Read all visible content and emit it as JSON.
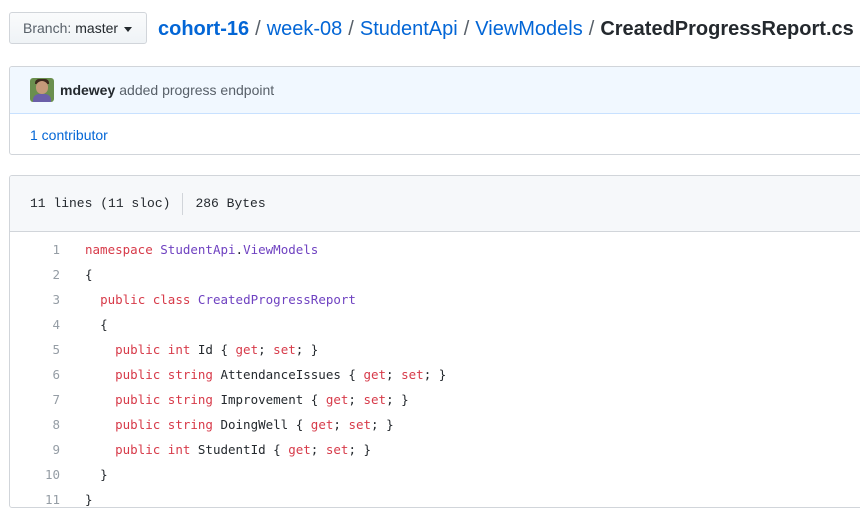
{
  "branch": {
    "prefix": "Branch:",
    "name": "master"
  },
  "breadcrumb": {
    "repo": "cohort-16",
    "parts": [
      "week-08",
      "StudentApi",
      "ViewModels"
    ],
    "file": "CreatedProgressReport.cs",
    "separator": "/"
  },
  "commit": {
    "author": "mdewey",
    "message": "added progress endpoint"
  },
  "contributors": {
    "label": "1 contributor"
  },
  "file_info": {
    "lines": "11 lines (11 sloc)",
    "size": "286 Bytes"
  },
  "code": [
    {
      "num": "1",
      "indent": "",
      "tokens": [
        [
          "kw-ty",
          "namespace"
        ],
        [
          "sp",
          " "
        ],
        [
          "ty",
          "StudentApi"
        ],
        [
          "pl",
          "."
        ],
        [
          "ty",
          "ViewModels"
        ]
      ]
    },
    {
      "num": "2",
      "indent": "",
      "tokens": [
        [
          "pl",
          "{"
        ]
      ]
    },
    {
      "num": "3",
      "indent": "  ",
      "tokens": [
        [
          "kw",
          "public"
        ],
        [
          "sp",
          " "
        ],
        [
          "kw",
          "class"
        ],
        [
          "sp",
          " "
        ],
        [
          "ty",
          "CreatedProgressReport"
        ]
      ]
    },
    {
      "num": "4",
      "indent": "  ",
      "tokens": [
        [
          "pl",
          "{"
        ]
      ]
    },
    {
      "num": "5",
      "indent": "    ",
      "tokens": [
        [
          "kw",
          "public"
        ],
        [
          "sp",
          " "
        ],
        [
          "kw",
          "int"
        ],
        [
          "pl",
          " Id { "
        ],
        [
          "kw",
          "get"
        ],
        [
          "pl",
          "; "
        ],
        [
          "kw",
          "set"
        ],
        [
          "pl",
          "; }"
        ]
      ]
    },
    {
      "num": "6",
      "indent": "    ",
      "tokens": [
        [
          "kw",
          "public"
        ],
        [
          "sp",
          " "
        ],
        [
          "kw",
          "string"
        ],
        [
          "pl",
          " AttendanceIssues { "
        ],
        [
          "kw",
          "get"
        ],
        [
          "pl",
          "; "
        ],
        [
          "kw",
          "set"
        ],
        [
          "pl",
          "; }"
        ]
      ]
    },
    {
      "num": "7",
      "indent": "    ",
      "tokens": [
        [
          "kw",
          "public"
        ],
        [
          "sp",
          " "
        ],
        [
          "kw",
          "string"
        ],
        [
          "pl",
          " Improvement { "
        ],
        [
          "kw",
          "get"
        ],
        [
          "pl",
          "; "
        ],
        [
          "kw",
          "set"
        ],
        [
          "pl",
          "; }"
        ]
      ]
    },
    {
      "num": "8",
      "indent": "    ",
      "tokens": [
        [
          "kw",
          "public"
        ],
        [
          "sp",
          " "
        ],
        [
          "kw",
          "string"
        ],
        [
          "pl",
          " DoingWell { "
        ],
        [
          "kw",
          "get"
        ],
        [
          "pl",
          "; "
        ],
        [
          "kw",
          "set"
        ],
        [
          "pl",
          "; }"
        ]
      ]
    },
    {
      "num": "9",
      "indent": "    ",
      "tokens": [
        [
          "kw",
          "public"
        ],
        [
          "sp",
          " "
        ],
        [
          "kw",
          "int"
        ],
        [
          "pl",
          " StudentId { "
        ],
        [
          "kw",
          "get"
        ],
        [
          "pl",
          "; "
        ],
        [
          "kw",
          "set"
        ],
        [
          "pl",
          "; }"
        ]
      ]
    },
    {
      "num": "10",
      "indent": "  ",
      "tokens": [
        [
          "pl",
          "}"
        ]
      ]
    },
    {
      "num": "11",
      "indent": "",
      "tokens": [
        [
          "pl",
          "}"
        ]
      ]
    }
  ],
  "colors": {
    "link": "#0366d6",
    "keyword": "#d73a49",
    "type": "#6f42c1",
    "namespace_keyword": "#d73a49"
  }
}
